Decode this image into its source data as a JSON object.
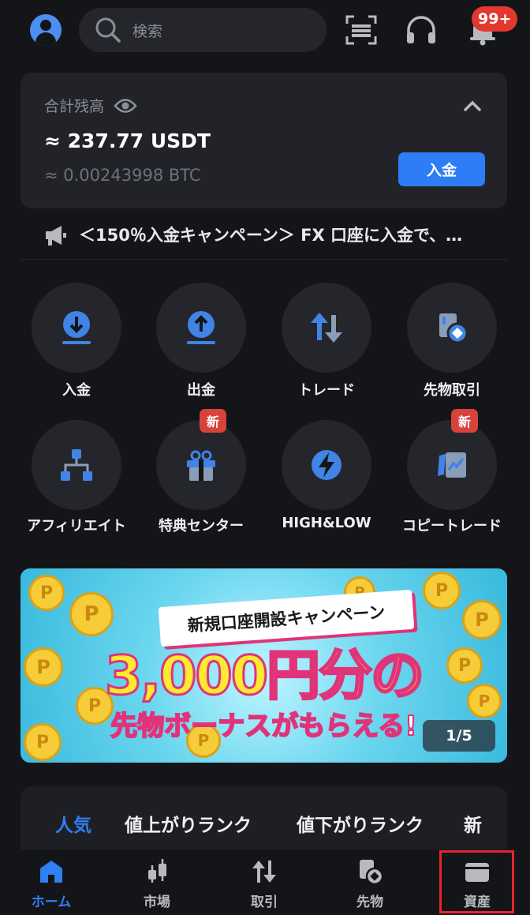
{
  "colors": {
    "background": "#141519",
    "accent": "#2e7cf6",
    "badge": "#e2382f",
    "highlight": "#e5262c"
  },
  "header": {
    "search_placeholder": "検索",
    "notification_count": "99+"
  },
  "balance": {
    "label": "合計残高",
    "usdt": "≈ 237.77 USDT",
    "btc": "≈ 0.00243998 BTC",
    "deposit_button": "入金"
  },
  "announcement": {
    "text": "＜150％入金キャンペーン＞ FX 口座に入金で、…"
  },
  "quick_actions": [
    {
      "label": "入金",
      "icon": "download-icon",
      "new": ""
    },
    {
      "label": "出金",
      "icon": "upload-icon",
      "new": ""
    },
    {
      "label": "トレード",
      "icon": "swap-arrows-icon",
      "new": ""
    },
    {
      "label": "先物取引",
      "icon": "futures-icon",
      "new": ""
    },
    {
      "label": "アフィリエイト",
      "icon": "network-icon",
      "new": ""
    },
    {
      "label": "特典センター",
      "icon": "gift-icon",
      "new": "新"
    },
    {
      "label": "HIGH&LOW",
      "icon": "lightning-icon",
      "new": ""
    },
    {
      "label": "コピートレード",
      "icon": "copy-trade-icon",
      "new": "新"
    }
  ],
  "banner": {
    "ribbon": "新規口座開設キャンペーン",
    "headline": "3,000円分の",
    "subline": "先物ボーナスがもらえる!",
    "pager": "1/5"
  },
  "ranking_tabs": [
    "人気",
    "値上がりランク",
    "値下がりランク",
    "新"
  ],
  "bottom_nav": [
    {
      "label": "ホーム",
      "icon": "home-icon",
      "active": true
    },
    {
      "label": "市場",
      "icon": "market-candles-icon",
      "active": false
    },
    {
      "label": "取引",
      "icon": "trade-arrows-icon",
      "active": false
    },
    {
      "label": "先物",
      "icon": "futures-icon",
      "active": false
    },
    {
      "label": "資産",
      "icon": "wallet-icon",
      "active": false
    }
  ]
}
